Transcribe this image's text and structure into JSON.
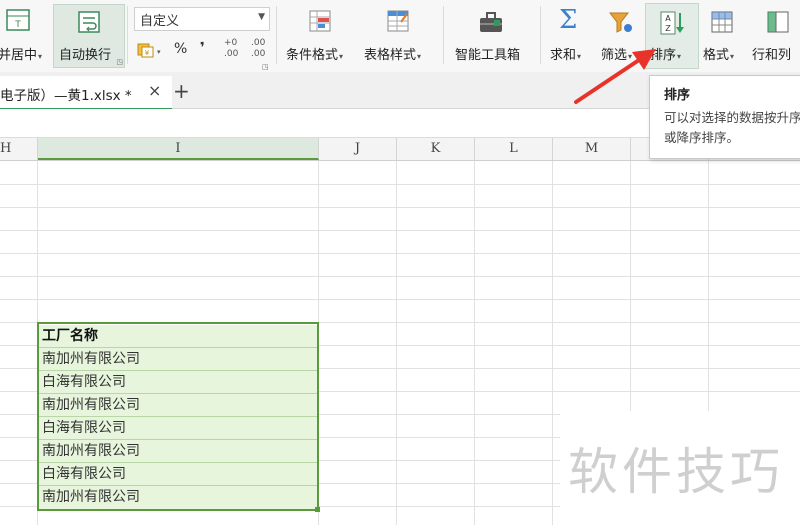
{
  "ribbon": {
    "merge_center_label": "并居中",
    "wrap_text_label": "自动换行",
    "number_format_value": "自定义",
    "percent_symbol": "%",
    "comma_symbol": "❜",
    "inc_decimal_label": ".00",
    "dec_decimal_label": ".00",
    "conditional_format_label": "条件格式",
    "table_style_label": "表格样式",
    "smart_toolbox_label": "智能工具箱",
    "sum_label": "求和",
    "filter_label": "筛选",
    "sort_label": "排序",
    "format_label": "格式",
    "rows_cols_label": "行和列"
  },
  "tabbar": {
    "file_tab_label": "电子版）—黄1.xlsx *",
    "close_glyph": "×",
    "new_tab_glyph": "+"
  },
  "columns": [
    "H",
    "I",
    "J",
    "K",
    "L",
    "M"
  ],
  "table": {
    "header": "工厂名称",
    "rows": [
      "南加州有限公司",
      "白海有限公司",
      "南加州有限公司",
      "白海有限公司",
      "南加州有限公司",
      "白海有限公司",
      "南加州有限公司"
    ]
  },
  "tooltip": {
    "title": "排序",
    "body": "可以对选择的数据按升序或降序排序。"
  },
  "watermark": "软件技巧",
  "colors": {
    "accent_green": "#2e9d5c",
    "table_fill": "#e6f5dc",
    "table_border": "#5b9a3c",
    "arrow_red": "#e8332a"
  }
}
